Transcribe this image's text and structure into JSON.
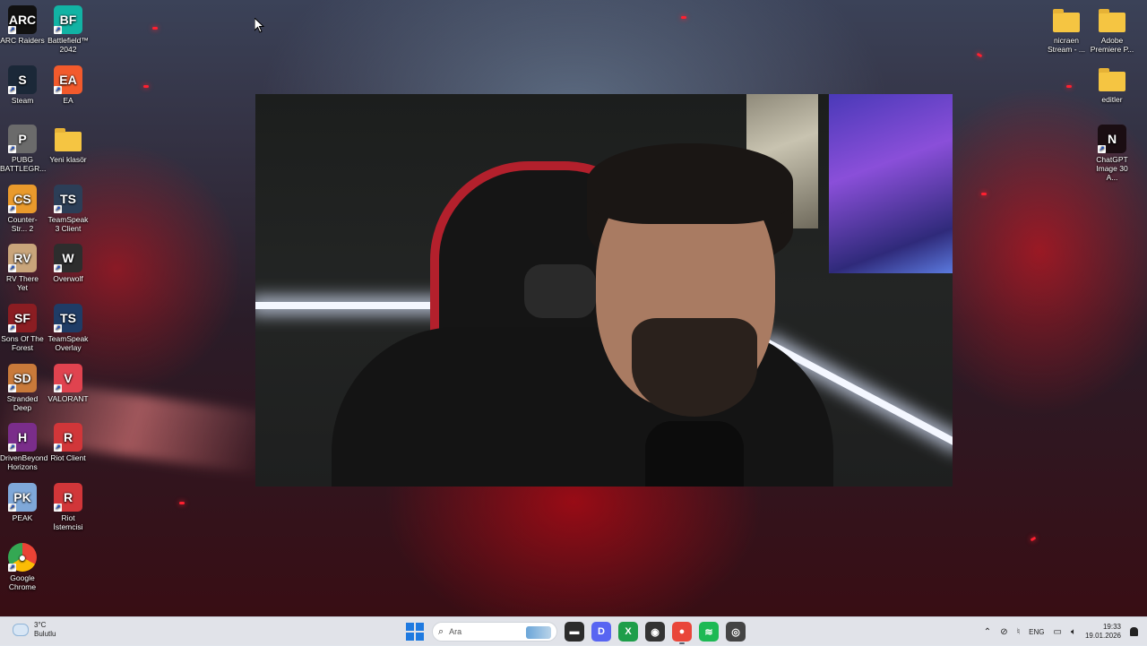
{
  "desktop_left": [
    {
      "id": "arc-raiders",
      "label": "ARC Raiders",
      "glyph": "ARC",
      "bg": "#111111"
    },
    {
      "id": "battlefield",
      "label": "Battlefield™ 2042",
      "glyph": "BF",
      "bg": "#12b3a4"
    },
    {
      "id": "steam",
      "label": "Steam",
      "glyph": "S",
      "bg": "#1b2838"
    },
    {
      "id": "ea",
      "label": "EA",
      "glyph": "EA",
      "bg": "#f25a2c"
    },
    {
      "id": "pubg",
      "label": "PUBG BATTLEGR...",
      "glyph": "P",
      "bg": "#6b6b6b"
    },
    {
      "id": "yeni-klasor",
      "label": "Yeni klasör",
      "glyph": "",
      "bg": "folder"
    },
    {
      "id": "counter-strike",
      "label": "Counter-Str... 2",
      "glyph": "CS",
      "bg": "#e99a2c"
    },
    {
      "id": "teamspeak-client",
      "label": "TeamSpeak 3 Client",
      "glyph": "TS",
      "bg": "#2c3e57"
    },
    {
      "id": "rv-there-yet",
      "label": "RV There Yet",
      "glyph": "RV",
      "bg": "#c9a57b"
    },
    {
      "id": "overwolf",
      "label": "Overwolf",
      "glyph": "W",
      "bg": "#2d2d2d"
    },
    {
      "id": "sons-of-forest",
      "label": "Sons Of The Forest",
      "glyph": "SF",
      "bg": "#8b1d22"
    },
    {
      "id": "teamspeak-overlay",
      "label": "TeamSpeak Overlay",
      "glyph": "TS",
      "bg": "#1f3c66"
    },
    {
      "id": "stranded-deep",
      "label": "Stranded Deep",
      "glyph": "SD",
      "bg": "#c97a3a"
    },
    {
      "id": "valorant",
      "label": "VALORANT",
      "glyph": "V",
      "bg": "#e0434f"
    },
    {
      "id": "dynasty-horizons",
      "label": "DrivenBeyond Horizons",
      "glyph": "H",
      "bg": "#7a2d8a"
    },
    {
      "id": "riot-client",
      "label": "Riot Client",
      "glyph": "R",
      "bg": "#d13639"
    },
    {
      "id": "peak",
      "label": "PEAK",
      "glyph": "PK",
      "bg": "#7fa8d9"
    },
    {
      "id": "riot-istemcisi",
      "label": "Riot İstemcisi",
      "glyph": "R",
      "bg": "#d13639"
    },
    {
      "id": "google-chrome",
      "label": "Google Chrome",
      "glyph": "●",
      "bg": "#ffffff"
    }
  ],
  "desktop_right": [
    {
      "id": "nicraen-stream",
      "label": "nicraen Stream - ...",
      "glyph": "",
      "bg": "folder"
    },
    {
      "id": "adobe-premiere",
      "label": "Adobe Premiere P...",
      "glyph": "",
      "bg": "folder"
    },
    {
      "id": "editler",
      "label": "editler",
      "glyph": "",
      "bg": "folder"
    },
    {
      "id": "chatgpt-image",
      "label": "ChatGPT Image 30 A...",
      "glyph": "N",
      "bg": "#1a0d12"
    }
  ],
  "taskbar": {
    "weather_temp": "3°C",
    "weather_desc": "Bulutlu",
    "search_placeholder": "Ara",
    "language": "ENG",
    "time": "19:33",
    "date": "19.01.2026",
    "apps": [
      {
        "id": "file-explorer",
        "glyph": "▬",
        "bg": "#2b2b2b"
      },
      {
        "id": "discord",
        "glyph": "D",
        "bg": "#5865f2"
      },
      {
        "id": "xbox",
        "glyph": "X",
        "bg": "#1e9e4a"
      },
      {
        "id": "app-steamlike",
        "glyph": "◉",
        "bg": "#333333"
      },
      {
        "id": "chrome",
        "glyph": "●",
        "bg": "#e9463a",
        "active": true
      },
      {
        "id": "spotify",
        "glyph": "≋",
        "bg": "#1db954"
      },
      {
        "id": "app-misc",
        "glyph": "◎",
        "bg": "#444444"
      }
    ]
  }
}
